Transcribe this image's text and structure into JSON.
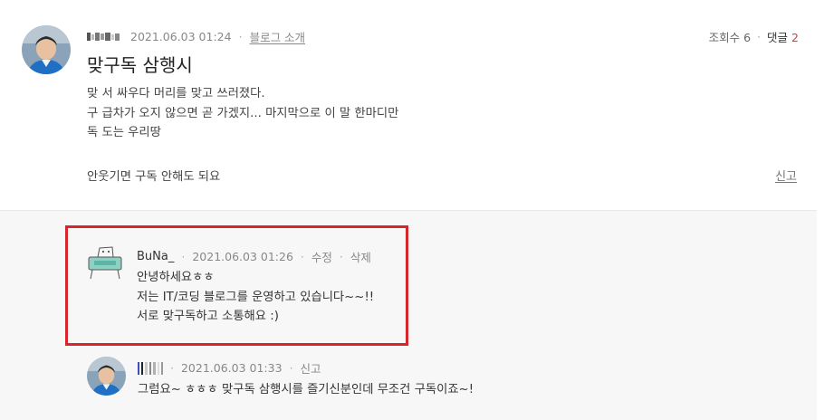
{
  "colors": {
    "highlight_border": "#d6252b",
    "comment_count": "#e53935",
    "comments_bg": "#f7f7f7"
  },
  "post": {
    "date": "2021.06.03 01:24",
    "category_link": "블로그 소개",
    "views_label": "조회수 6",
    "comments_label": "댓글",
    "comments_count": "2",
    "title": "맞구독 삼행시",
    "body_lines": [
      "맞 서 싸우다 머리를 맞고 쓰러졌다.",
      "구 급차가 오지 않으면 곧 가겠지... 마지막으로 이 말 한마디만",
      "독 도는 우리땅"
    ],
    "footer": "안웃기면 구독 안해도 되요",
    "report": "신고"
  },
  "comments": [
    {
      "author": "BuNa_",
      "date": "2021.06.03 01:26",
      "edit": "수정",
      "delete": "삭제",
      "lines": [
        "안녕하세요ㅎㅎ",
        "저는 IT/코딩 블로그를 운영하고 있습니다~~!!",
        "서로 맞구독하고 소통해요 :)"
      ]
    },
    {
      "date": "2021.06.03 01:33",
      "report": "신고",
      "text": "그럼요~ ㅎㅎㅎ 맞구독 삼행시를 즐기신분인데 무조건 구독이죠~!"
    }
  ]
}
